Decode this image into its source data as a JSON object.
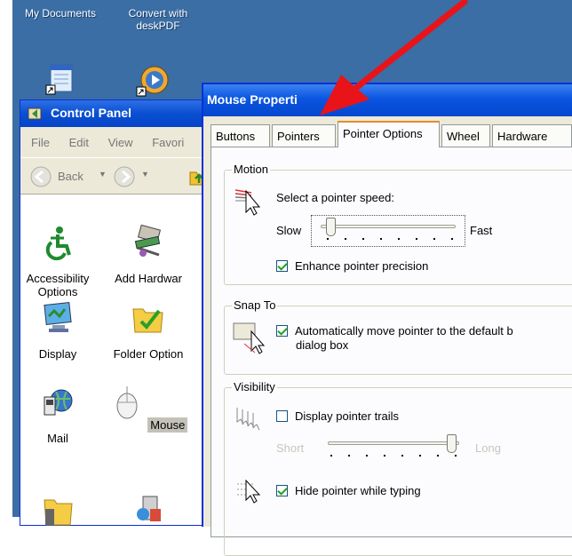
{
  "desktop": {
    "icons": [
      {
        "label": "My Documents"
      },
      {
        "label_line1": "Convert with",
        "label_line2": "deskPDF"
      }
    ]
  },
  "control_panel": {
    "title": "Control Panel",
    "menu": [
      "File",
      "Edit",
      "View",
      "Favori"
    ],
    "back_label": "Back",
    "items": [
      {
        "label_line1": "Accessibility",
        "label_line2": "Options",
        "icon": "accessibility-icon"
      },
      {
        "label_line1": "Add Hardwar",
        "label_line2": "",
        "icon": "add-hardware-icon"
      },
      {
        "label_line1": "Display",
        "label_line2": "",
        "icon": "display-icon"
      },
      {
        "label_line1": "Folder Option",
        "label_line2": "",
        "icon": "folder-options-icon"
      },
      {
        "label_line1": "Mail",
        "label_line2": "",
        "icon": "mail-icon"
      },
      {
        "label_line1": "Mouse",
        "label_line2": "",
        "icon": "mouse-icon",
        "selected": true
      }
    ]
  },
  "dialog": {
    "title": "Mouse Properti",
    "tabs": [
      {
        "label": "Buttons"
      },
      {
        "label": "Pointers"
      },
      {
        "label": "Pointer Options",
        "active": true
      },
      {
        "label": "Wheel"
      },
      {
        "label": "Hardware"
      }
    ],
    "motion": {
      "group_label": "Motion",
      "prompt": "Select a pointer speed:",
      "slow_label": "Slow",
      "fast_label": "Fast",
      "speed_level": 0.05,
      "precision_label": "Enhance pointer precision",
      "precision_checked": true
    },
    "snap_to": {
      "group_label": "Snap To",
      "line1": "Automatically move pointer to the default b",
      "line2": "dialog box",
      "checked": true
    },
    "visibility": {
      "group_label": "Visibility",
      "trails_label": "Display pointer trails",
      "trails_checked": false,
      "short_label": "Short",
      "long_label": "Long",
      "trail_length": 1.0,
      "hide_label": "Hide pointer while typing",
      "hide_checked": true
    }
  },
  "annotation": {
    "arrow_color": "#e8141a"
  }
}
